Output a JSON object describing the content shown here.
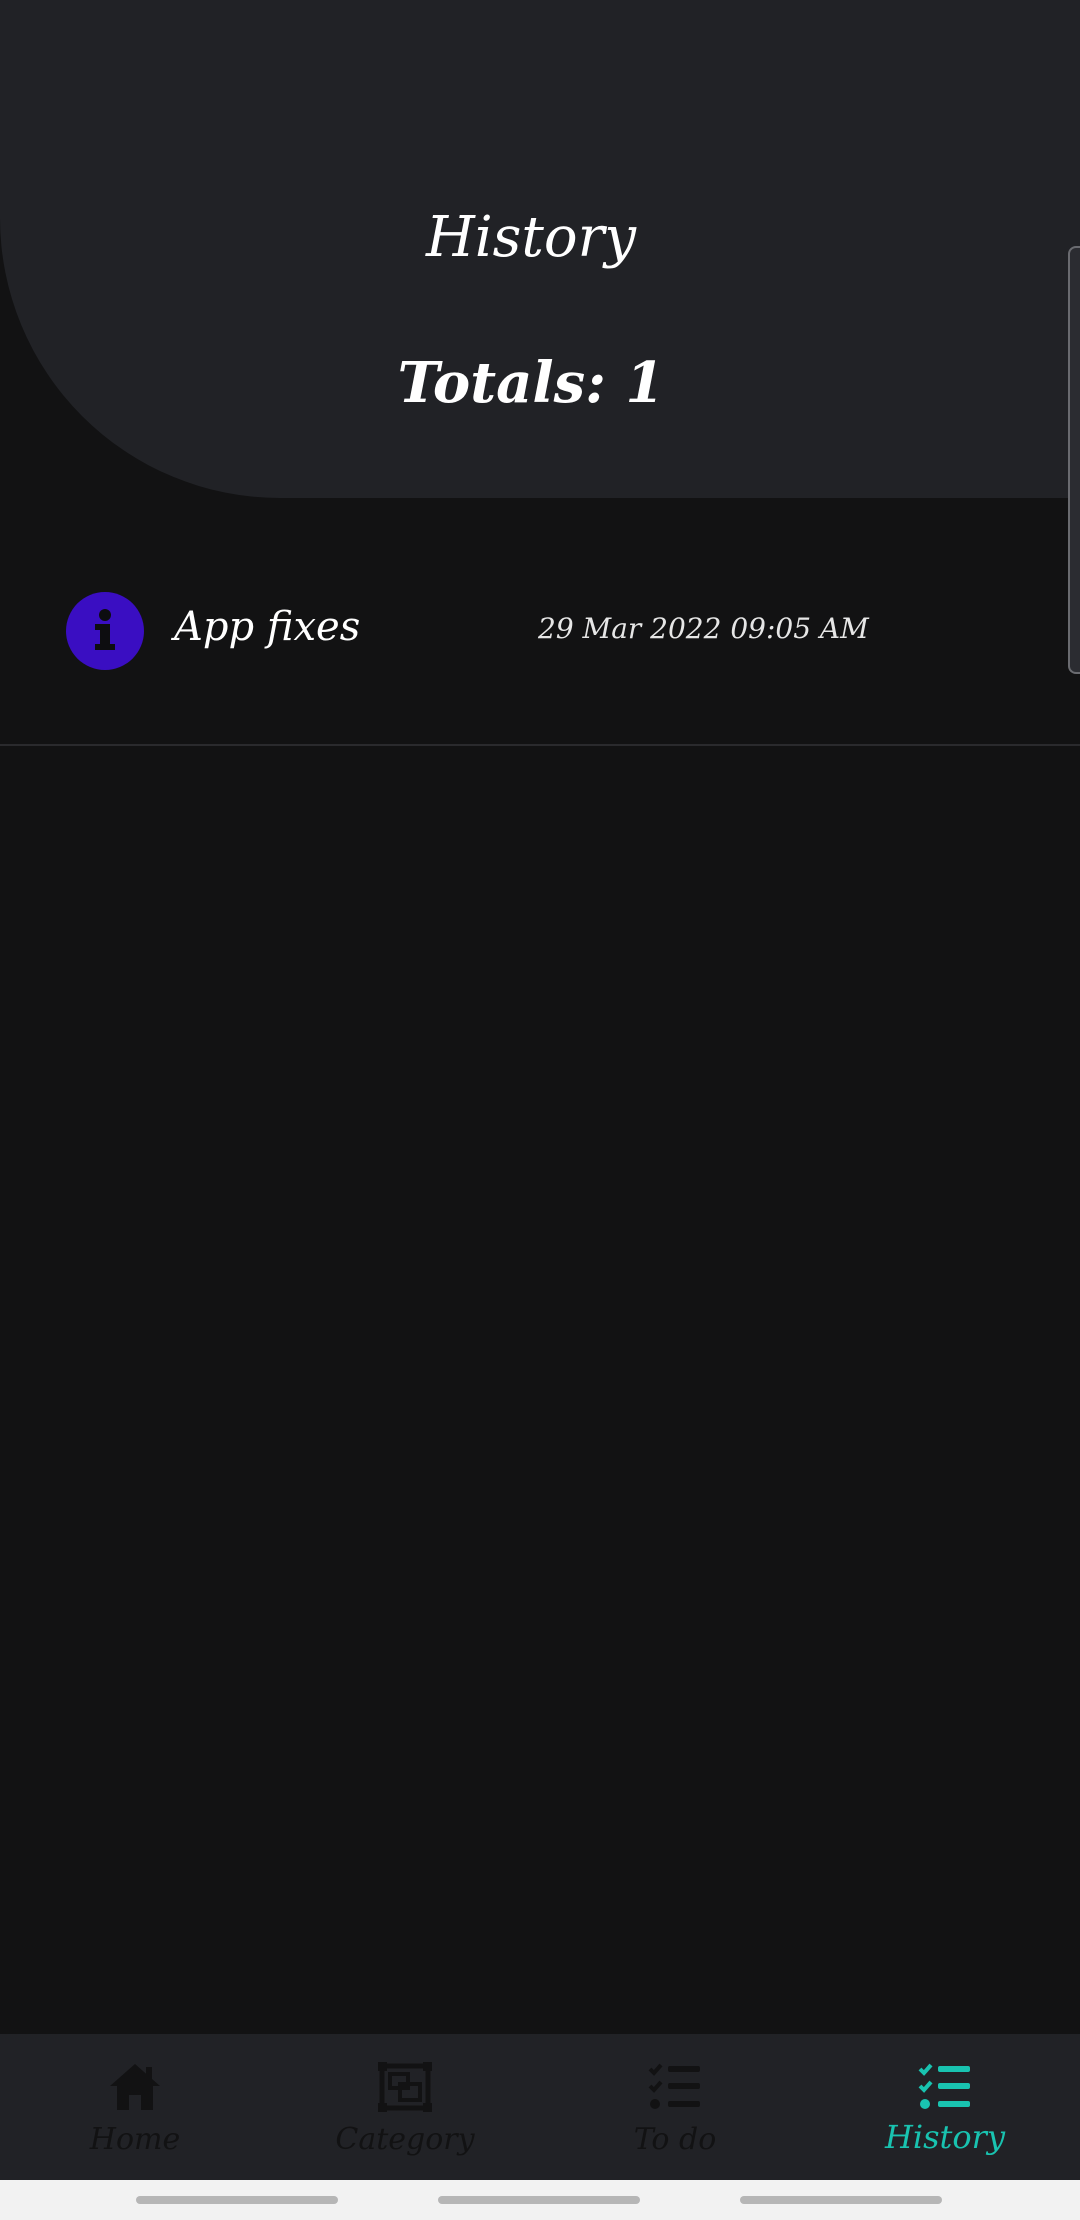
{
  "header": {
    "title": "History",
    "totals": "Totals: 1"
  },
  "history": {
    "items": [
      {
        "icon": "info-icon",
        "title": "App fixes",
        "date": "29 Mar 2022 09:05 AM"
      }
    ]
  },
  "nav": {
    "items": [
      {
        "label": "Home",
        "icon": "home-icon"
      },
      {
        "label": "Category",
        "icon": "category-icon"
      },
      {
        "label": "To do",
        "icon": "todo-list-icon"
      },
      {
        "label": "History",
        "icon": "history-list-icon"
      }
    ],
    "active": "History"
  },
  "colors": {
    "background": "#121213",
    "header": "#212226",
    "accent": "#19c3b0",
    "icon_bg": "#3a0ec2",
    "nav_inactive": "#121213"
  }
}
